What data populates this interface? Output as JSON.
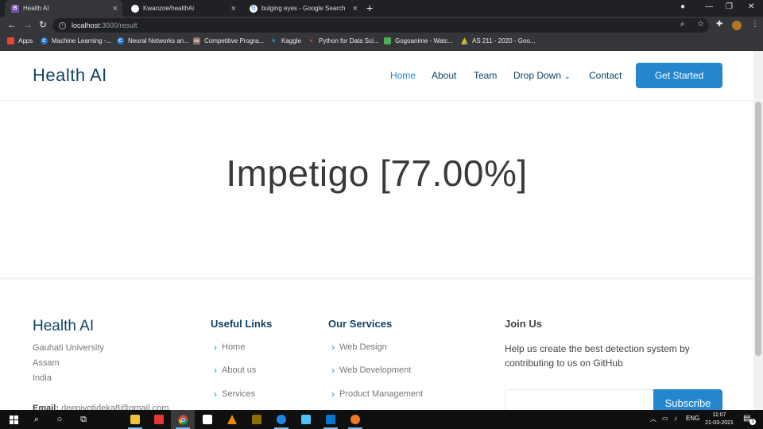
{
  "browser": {
    "tabs": [
      {
        "title": "Health AI",
        "favicon_letter": "B",
        "favicon_color": "#7952b3",
        "active": true
      },
      {
        "title": "Kwanzoe/healthAi",
        "favicon_letter": "",
        "favicon_color": "#ffffff",
        "active": false
      },
      {
        "title": "bulging eyes - Google Search",
        "favicon_letter": "G",
        "favicon_color": "#4285f4",
        "active": false
      }
    ],
    "address": {
      "host": "localhost",
      "path": ":3000/result"
    },
    "bookmarks": [
      {
        "label": "Apps",
        "icon": "apps-grid-icon",
        "color": "#ea4335"
      },
      {
        "label": "Machine Learning -...",
        "icon": "coursera-icon",
        "color": "#2a73cc"
      },
      {
        "label": "Neural Networks an...",
        "icon": "coursera-icon",
        "color": "#2a73cc"
      },
      {
        "label": "Competitive Progra...",
        "icon": "cc-icon",
        "color": "#8d6e63"
      },
      {
        "label": "Kaggle",
        "icon": "kaggle-icon",
        "color": "#20beff"
      },
      {
        "label": "Python for Data Sci...",
        "icon": "python-icon",
        "color": "#e8453c"
      },
      {
        "label": "Gogoanime - Watc...",
        "icon": "gogo-icon",
        "color": "#4caf50"
      },
      {
        "label": "AS 211 - 2020 - Goo...",
        "icon": "drive-icon",
        "color": "#fbbc04"
      }
    ]
  },
  "site": {
    "logo": "Health AI",
    "nav": [
      {
        "label": "Home",
        "active": true
      },
      {
        "label": "About",
        "active": false
      },
      {
        "label": "Team",
        "active": false
      },
      {
        "label": "Drop Down",
        "active": false
      },
      {
        "label": "Contact",
        "active": false
      }
    ],
    "cta": "Get Started",
    "result": "Impetigo [77.00%]"
  },
  "footer": {
    "brand": "Health AI",
    "address": [
      "Gauhati University",
      "Assam",
      "India"
    ],
    "email_label": "Email:",
    "email_value": "deepjyotideka8@gmail.com",
    "useful_links_title": "Useful Links",
    "useful_links": [
      "Home",
      "About us",
      "Services"
    ],
    "services_title": "Our Services",
    "services": [
      "Web Design",
      "Web Development",
      "Product Management"
    ],
    "join_title": "Join Us",
    "join_text": "Help us create the best detection system by contributing to us on GitHub",
    "subscribe": "Subscribe"
  },
  "taskbar": {
    "time": "11:07",
    "date": "21-03-2021",
    "lang": "ENG",
    "notification_count": "3"
  },
  "colors": {
    "brand_dark": "#124265",
    "accent": "#2487ce",
    "browser_dark": "#202124",
    "browser_mid": "#35363a"
  }
}
